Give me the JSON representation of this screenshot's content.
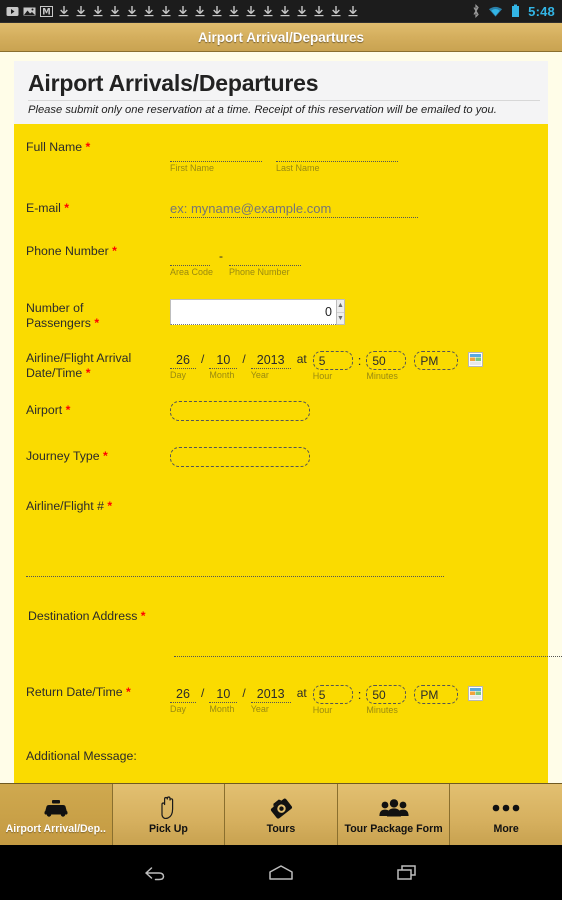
{
  "status_bar": {
    "download_icon_count": 16,
    "icons": [
      "back-badge-icon",
      "image-icon",
      "m-badge-icon"
    ],
    "bluetooth": "bluetooth-icon",
    "wifi": "wifi-icon",
    "battery": "battery-icon",
    "clock": "5:48",
    "clock_color": "#33b5e5"
  },
  "title_bar": {
    "title": "Airport Arrival/Departures"
  },
  "form": {
    "heading": "Airport Arrivals/Departures",
    "subheading": "Please submit only one reservation at a time. Receipt of this reservation will be emailed to you.",
    "background_color": "#FADB00",
    "required_marker": "*",
    "fields": {
      "full_name": {
        "label": "Full Name",
        "required": true,
        "first": {
          "value": "",
          "sublabel": "First Name"
        },
        "last": {
          "value": "",
          "sublabel": "Last Name"
        }
      },
      "email": {
        "label": "E-mail",
        "required": true,
        "value": "",
        "placeholder": "ex: myname@example.com"
      },
      "phone": {
        "label": "Phone Number",
        "required": true,
        "separator": "-",
        "area": {
          "value": "",
          "sublabel": "Area Code"
        },
        "number": {
          "value": "",
          "sublabel": "Phone Number"
        }
      },
      "passengers": {
        "label": "Number of Passengers",
        "label_line1": "Number of",
        "label_line2": "Passengers",
        "required": true,
        "value": "0"
      },
      "arrival_datetime": {
        "label": "Airline/Flight Arrival Date/Time",
        "label_line1": "Airline/Flight Arrival",
        "label_line2": "Date/Time",
        "required": true,
        "day": "26",
        "day_sub": "Day",
        "month": "10",
        "month_sub": "Month",
        "year": "2013",
        "year_sub": "Year",
        "at": "at",
        "hour": "5",
        "hour_sub": "Hour",
        "colon": ":",
        "minutes": "50",
        "minutes_sub": "Minutes",
        "ampm": "PM",
        "picker": "calendar-icon"
      },
      "airport": {
        "label": "Airport",
        "required": true,
        "value": ""
      },
      "journey_type": {
        "label": "Journey Type",
        "required": true,
        "value": ""
      },
      "airline_flight": {
        "label": "Airline/Flight #",
        "required": true,
        "value": ""
      },
      "destination_address": {
        "label": "Destination Address",
        "required": true,
        "value": ""
      },
      "return_datetime": {
        "label": "Return Date/Time",
        "required": true,
        "day": "26",
        "day_sub": "Day",
        "month": "10",
        "month_sub": "Month",
        "year": "2013",
        "year_sub": "Year",
        "at": "at",
        "hour": "5",
        "hour_sub": "Hour",
        "colon": ":",
        "minutes": "50",
        "minutes_sub": "Minutes",
        "ampm": "PM",
        "picker": "calendar-icon"
      },
      "additional_message": {
        "label": "Additional Message:",
        "required": false,
        "value": ""
      }
    }
  },
  "tab_bar": {
    "tabs": [
      {
        "label": "Airport Arrival/Dep..",
        "icon": "taxi-icon",
        "active": true
      },
      {
        "label": "Pick Up",
        "icon": "hand-icon",
        "active": false
      },
      {
        "label": "Tours",
        "icon": "camera-icon",
        "active": false
      },
      {
        "label": "Tour Package Form",
        "icon": "people-icon",
        "active": false
      },
      {
        "label": "More",
        "icon": "ellipsis-icon",
        "active": false
      }
    ]
  },
  "nav_bar": {
    "buttons": [
      {
        "name": "back-icon"
      },
      {
        "name": "home-icon"
      },
      {
        "name": "recents-icon"
      }
    ]
  }
}
